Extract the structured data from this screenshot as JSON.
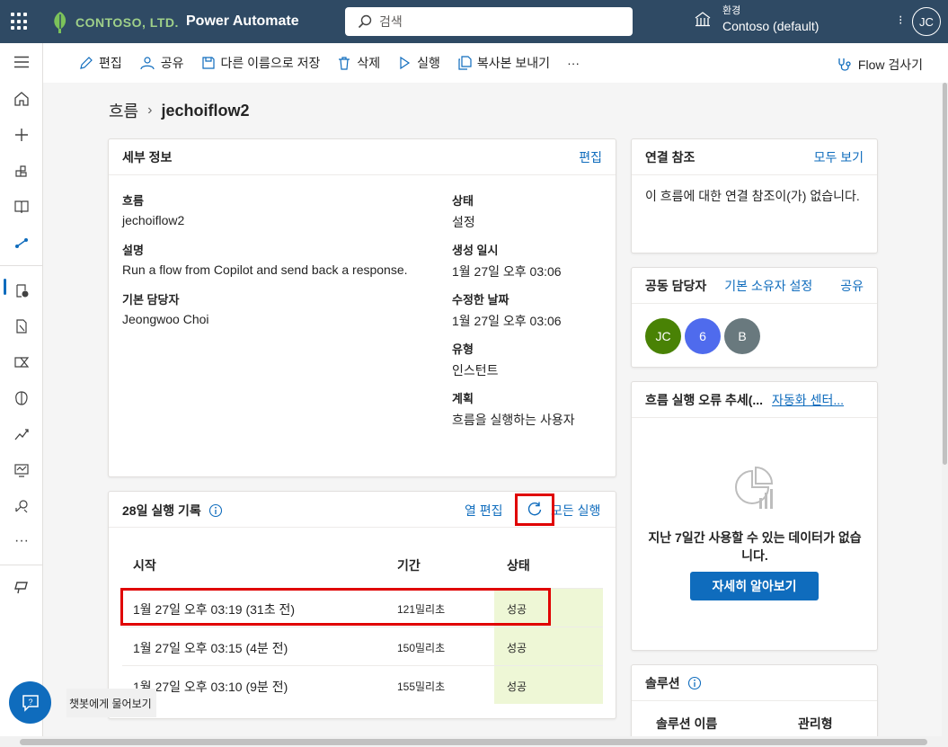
{
  "header": {
    "company": "CONTOSO, LTD.",
    "app_name": "Power Automate",
    "search_placeholder": "검색",
    "env_label": "환경",
    "env_name": "Contoso (default)",
    "user_initials": "JC"
  },
  "commands": {
    "edit": "편집",
    "share": "공유",
    "save_as": "다른 이름으로 저장",
    "delete": "삭제",
    "run": "실행",
    "send_copy": "복사본 보내기",
    "more": "···",
    "flow_checker": "Flow 검사기"
  },
  "breadcrumb": {
    "root": "흐름",
    "separator": "›",
    "current": "jechoiflow2"
  },
  "details": {
    "title": "세부 정보",
    "edit_link": "편집",
    "flow_label": "흐름",
    "flow_value": "jechoiflow2",
    "desc_label": "설명",
    "desc_value": "Run a flow from Copilot and send back a response.",
    "owner_label": "기본 담당자",
    "owner_value": "Jeongwoo Choi",
    "status_label": "상태",
    "status_value": "설정",
    "created_label": "생성 일시",
    "created_value": "1월 27일 오후 03:06",
    "modified_label": "수정한 날짜",
    "modified_value": "1월 27일 오후 03:06",
    "type_label": "유형",
    "type_value": "인스턴트",
    "plan_label": "계획",
    "plan_value": "흐름을 실행하는 사용자"
  },
  "runs": {
    "title": "28일 실행 기록",
    "edit_columns": "열 편집",
    "all_runs": "모든 실행",
    "headers": {
      "start": "시작",
      "duration": "기간",
      "status": "상태"
    },
    "rows": [
      {
        "start": "1월 27일 오후 03:19 (31초 전)",
        "duration": "121밀리초",
        "status": "성공"
      },
      {
        "start": "1월 27일 오후 03:15 (4분 전)",
        "duration": "150밀리초",
        "status": "성공"
      },
      {
        "start": "1월 27일 오후 03:10 (9분 전)",
        "duration": "155밀리초",
        "status": "성공"
      }
    ]
  },
  "connections": {
    "title": "연결 참조",
    "see_all": "모두 보기",
    "empty_text": "이 흐름에 대한 연결 참조이(가) 없습니다."
  },
  "coowners": {
    "title": "공동 담당자",
    "set_owner": "기본 소유자 설정",
    "share": "공유",
    "avatars": [
      {
        "initials": "JC",
        "color": "#498205"
      },
      {
        "initials": "6",
        "color": "#4f6bed"
      },
      {
        "initials": "B",
        "color": "#69797e"
      }
    ]
  },
  "errors": {
    "title": "흐름 실행 오류 추세(...",
    "center_link": "자동화 센터...",
    "no_data": "지난 7일간 사용할 수 있는 데이터가 없습니다.",
    "learn_more": "자세히 알아보기"
  },
  "solutions": {
    "title": "솔루션",
    "col_name": "솔루션 이름",
    "col_managed": "관리형"
  },
  "chat": {
    "label": "챗봇에게 물어보기"
  },
  "colors": {
    "topbar": "#2f4a64",
    "accent": "#0f6cbd",
    "success_bg": "#eef7d6",
    "highlight": "#e00000"
  }
}
